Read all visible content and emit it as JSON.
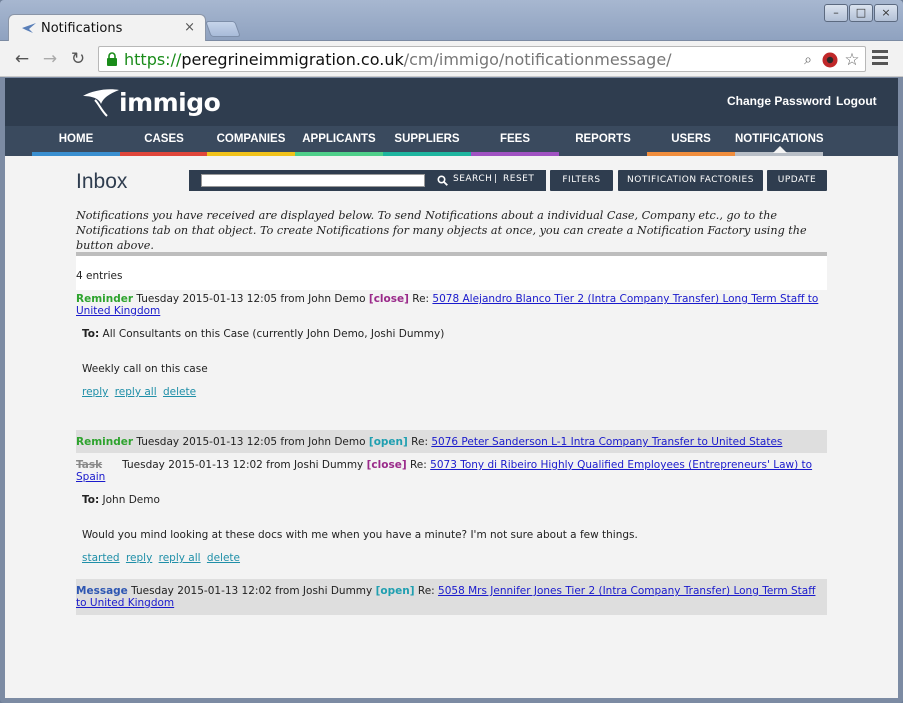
{
  "browser": {
    "tab_title": "Notifications",
    "close_glyph": "×",
    "url_scheme": "https://",
    "url_host": "peregrineimmigration.co.uk",
    "url_path": "/cm/immigo/notificationmessage/",
    "window_buttons": [
      "–",
      "□",
      "×"
    ]
  },
  "header": {
    "logo_text": "immigo",
    "change_password": "Change Password",
    "logout": "Logout"
  },
  "nav": {
    "items": [
      {
        "label": "HOME",
        "color": "#3a8fd0"
      },
      {
        "label": "CASES",
        "color": "#e0463a"
      },
      {
        "label": "COMPANIES",
        "color": "#f1c21a"
      },
      {
        "label": "APPLICANTS",
        "color": "#4fcf8a"
      },
      {
        "label": "SUPPLIERS",
        "color": "#1eb59f"
      },
      {
        "label": "FEES",
        "color": "#a052c2"
      },
      {
        "label": "REPORTS",
        "color": "#3a4a5e"
      },
      {
        "label": "USERS",
        "color": "#f08d3c"
      },
      {
        "label": "NOTIFICATIONS",
        "color": "#b8bec6"
      }
    ]
  },
  "toolbar": {
    "heading": "Inbox",
    "search_value": "",
    "search_label": "SEARCH",
    "separator": "|",
    "reset_label": "RESET",
    "filters_label": "FILTERS",
    "factories_label": "NOTIFICATION FACTORIES",
    "update_label": "UPDATE"
  },
  "intro_text": "Notifications you have received are displayed below. To send Notifications about a individual Case, Company etc., go to the Notifications tab on that object. To create Notifications for many objects at once, you can create a Notification Factory using the button above.",
  "entries_count": "4 entries",
  "messages": [
    {
      "kind": "Reminder",
      "date": "Tuesday 2015-01-13 12:05 from John Demo",
      "state": "[close]",
      "re": "Re:",
      "subject": "5078 Alejandro Blanco Tier 2 (Intra Company Transfer) Long Term Staff to United Kingdom",
      "to_label": "To:",
      "to": "All Consultants on this Case (currently John Demo, Joshi Dummy)",
      "body": "Weekly call on this case",
      "actions": [
        "reply",
        "reply all",
        "delete"
      ]
    },
    {
      "kind": "Reminder",
      "date": "Tuesday 2015-01-13 12:05 from John Demo",
      "state": "[open]",
      "re": "Re:",
      "subject": "5076 Peter Sanderson L-1 Intra Company Transfer to United States"
    },
    {
      "kind": "Task",
      "date": "Tuesday 2015-01-13 12:02 from Joshi Dummy",
      "state": "[close]",
      "re": "Re:",
      "subject": "5073 Tony di Ribeiro Highly Qualified Employees (Entrepreneurs' Law) to Spain",
      "to_label": "To:",
      "to": "John Demo",
      "body": "Would you mind looking at these docs with me when you have a minute?  I'm not sure about a few things.",
      "actions": [
        "started",
        "reply",
        "reply all",
        "delete"
      ]
    },
    {
      "kind": "Message",
      "date": "Tuesday 2015-01-13 12:02 from Joshi Dummy",
      "state": "[open]",
      "re": "Re:",
      "subject": "5058 Mrs Jennifer Jones Tier 2 (Intra Company Transfer) Long Term Staff to United Kingdom"
    }
  ]
}
